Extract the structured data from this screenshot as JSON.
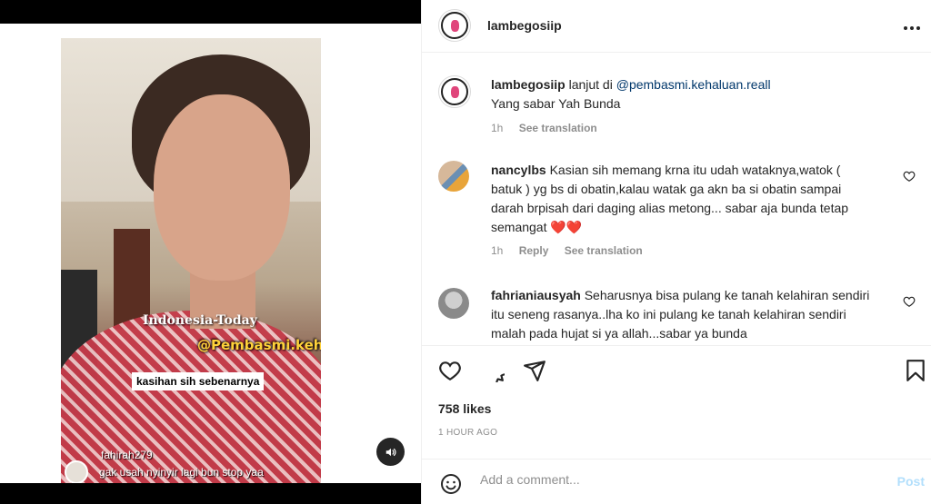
{
  "media": {
    "watermark_top": "Indonesia-Today",
    "watermark_handle": "@Pembasmi.kehaluan.reall",
    "caption": "kasihan sih sebenarnya",
    "overlay_comment_user": "fahirah279",
    "overlay_comment_text": "gak usah nyinyir lagi bun stop yaa"
  },
  "header": {
    "username": "lambegosiip",
    "more_icon": "more-horizontal-icon"
  },
  "post": {
    "author": "lambegosiip",
    "text_prefix": "lanjut di",
    "mention": "@pembasmi.kehaluan.reall",
    "line2": "Yang sabar Yah Bunda",
    "time": "1h",
    "see_translation": "See translation"
  },
  "comments": [
    {
      "user": "nancylbs",
      "text": "Kasian sih memang krna itu udah wataknya,watok ( batuk ) yg bs di obatin,kalau watak ga akn ba si obatin sampai darah brpisah dari daging alias metong... sabar aja bunda tetap semangat ❤️❤️",
      "time": "1h",
      "reply": "Reply",
      "see_translation": "See translation"
    },
    {
      "user": "fahrianiausyah",
      "text": "Seharusnya bisa pulang ke tanah kelahiran sendiri itu seneng rasanya..lha ko ini pulang ke tanah kelahiran sendiri malah pada hujat si ya allah...sabar ya bunda"
    }
  ],
  "actions": {
    "likes": "758 likes",
    "time_ago": "1 HOUR AGO"
  },
  "composer": {
    "placeholder": "Add a comment...",
    "post_label": "Post"
  },
  "colors": {
    "link": "#00376b",
    "muted": "#8e8e8e",
    "post_disabled": "#b2dffc",
    "heart_red": "#ed4956"
  }
}
